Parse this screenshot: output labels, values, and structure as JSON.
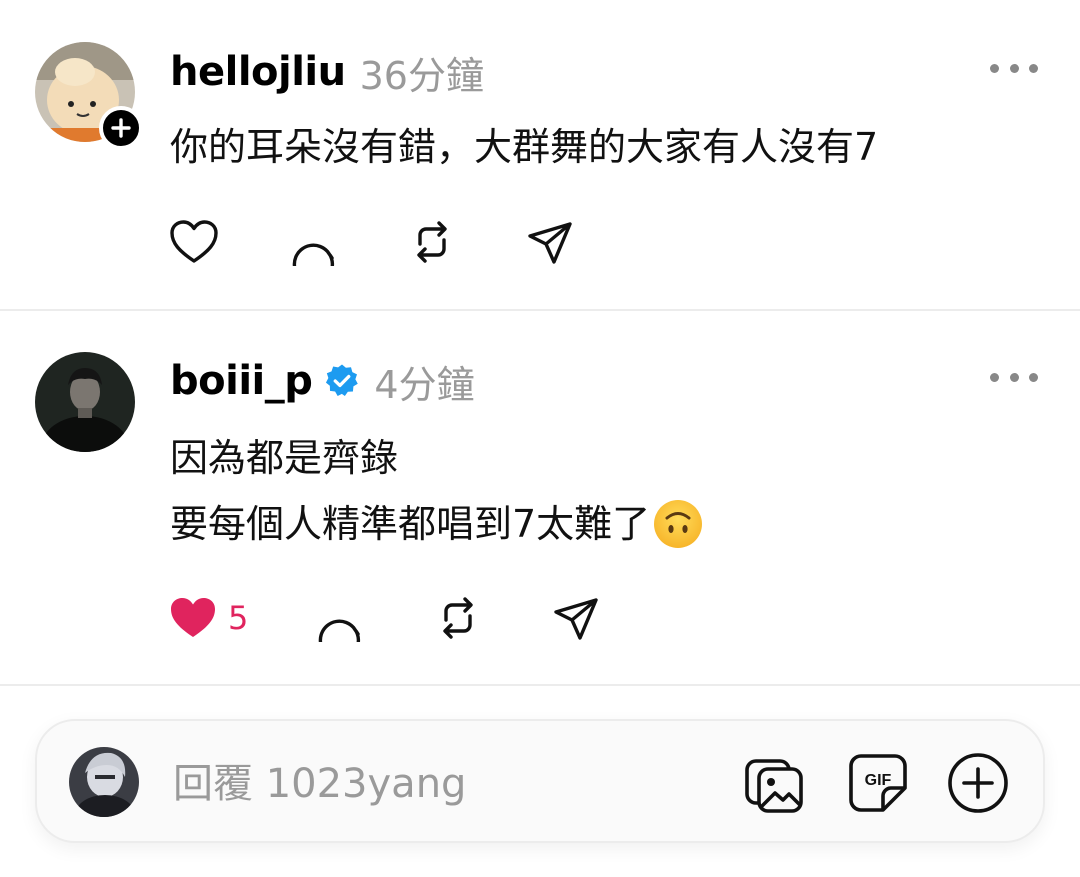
{
  "posts": [
    {
      "username": "hellojliu",
      "time": "36分鐘",
      "text": [
        "你的耳朵沒有錯，大群舞的大家有人沒有7"
      ],
      "liked": false,
      "like_count": "",
      "verified": false,
      "follow_badge": true,
      "avatar_icon": "mascot-avatar"
    },
    {
      "username": "boiii_p",
      "time": "4分鐘",
      "text": [
        "因為都是齊錄",
        "要每個人精準都唱到7太難了"
      ],
      "trailing_emoji": "upside-down-face-emoji",
      "liked": true,
      "like_count": "5",
      "verified": true,
      "follow_badge": false,
      "avatar_icon": "person-avatar"
    }
  ],
  "actions": [
    "heart-icon",
    "comment-icon",
    "repost-icon",
    "share-icon"
  ],
  "reply": {
    "placeholder": "回覆 1023yang",
    "icons": [
      "gallery-icon",
      "gif-icon",
      "add-icon"
    ]
  },
  "colors": {
    "like": "#e0245e",
    "verified": "#1d9bf0",
    "muted": "#9a9a9a",
    "divider": "#ececec"
  }
}
